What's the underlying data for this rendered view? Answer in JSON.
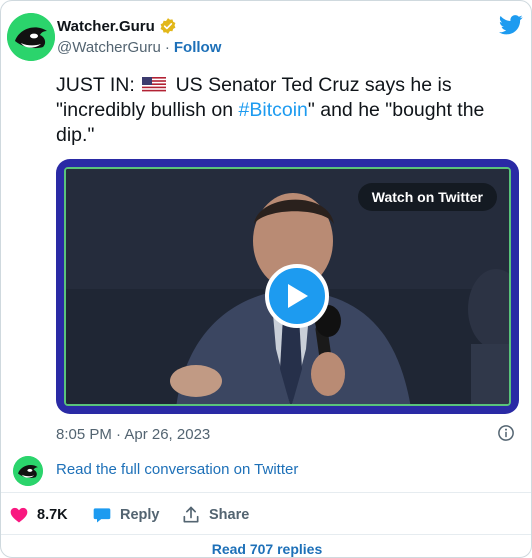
{
  "account": {
    "name": "Watcher.Guru",
    "handle": "@WatcherGuru",
    "separator": "·",
    "follow_label": "Follow"
  },
  "tweet": {
    "text_prefix": "JUST IN: ",
    "text_part1": " US Senator Ted Cruz says he is \"incredibly bullish on ",
    "hashtag": "#Bitcoin",
    "text_part2": "\" and he \"bought the dip.\"",
    "timestamp": "8:05 PM · Apr 26, 2023"
  },
  "media": {
    "watch_label": "Watch on Twitter"
  },
  "conversation_link": "Read the full conversation on Twitter",
  "actions": {
    "likes_count": "8.7K",
    "reply_label": "Reply",
    "share_label": "Share"
  },
  "read_replies_label": "Read 707 replies",
  "icons": {
    "verified": "verified-badge-icon",
    "twitter": "twitter-bird-icon",
    "flag": "us-flag-icon",
    "info": "info-icon",
    "like": "heart-icon",
    "reply": "reply-bubble-icon",
    "share": "share-icon",
    "play": "play-icon"
  },
  "colors": {
    "link": "#1d70b8",
    "hashtag": "#1d9bf0",
    "heart": "#f91880",
    "media_border": "#2a2aa5",
    "avatar_green": "#2bd46c",
    "verified_gold": "#e2b719"
  }
}
